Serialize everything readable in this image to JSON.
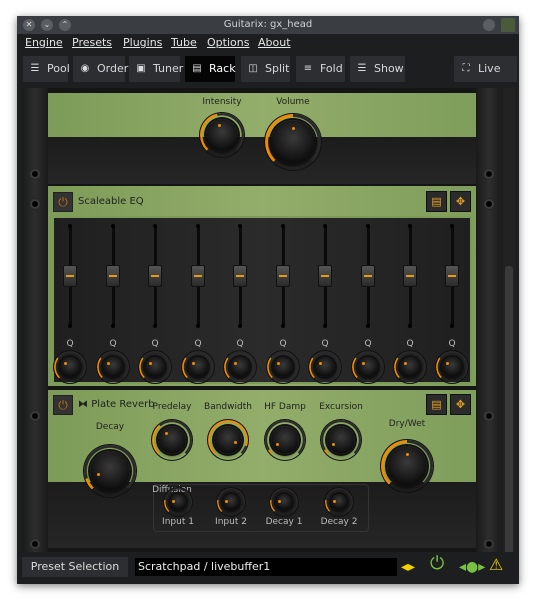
{
  "window": {
    "title": "Guitarix: gx_head"
  },
  "menu": [
    "Engine",
    "Presets",
    "Plugins",
    "Tube",
    "Options",
    "About"
  ],
  "toolbar": {
    "buttons": [
      {
        "label": "Pool",
        "icon": "list-icon"
      },
      {
        "label": "Order",
        "icon": "circle-icon"
      },
      {
        "label": "Tuner",
        "icon": "tuner-icon"
      },
      {
        "label": "Rack",
        "icon": "rack-icon",
        "active": true
      },
      {
        "label": "Split",
        "icon": "split-icon"
      },
      {
        "label": "Fold",
        "icon": "fold-icon"
      },
      {
        "label": "Show",
        "icon": "show-icon"
      },
      {
        "label": "Live",
        "icon": "fullscreen-icon"
      }
    ]
  },
  "top_panel": {
    "knobs": [
      {
        "label": "Intensity",
        "value": 0.45
      },
      {
        "label": "Volume",
        "value": 0.5
      }
    ]
  },
  "eq": {
    "title": "Scaleable EQ",
    "band_label": "Q",
    "bands": 10,
    "slider_value": 0.5,
    "q_value": 0.3
  },
  "reverb": {
    "title": "Plate Reverb",
    "knobs": [
      {
        "label": "Decay",
        "value": 0.1
      },
      {
        "label": "Predelay",
        "value": 0.35
      },
      {
        "label": "Bandwidth",
        "value": 0.9
      },
      {
        "label": "HF Damp",
        "value": 0.05
      },
      {
        "label": "Excursion",
        "value": 0.05
      },
      {
        "label": "Dry/Wet",
        "value": 0.5
      }
    ],
    "diffusion": {
      "label": "Diffusion",
      "knobs": [
        {
          "label": "Input 1",
          "value": 0.2
        },
        {
          "label": "Input 2",
          "value": 0.2
        },
        {
          "label": "Decay 1",
          "value": 0.2
        },
        {
          "label": "Decay 2",
          "value": 0.2
        }
      ]
    }
  },
  "status": {
    "preset_button": "Preset Selection",
    "preset_name": "Scratchpad / livebuffer1"
  },
  "colors": {
    "accent": "#f08c00",
    "panel_green": "#8aa763",
    "ok": "#7ac142",
    "warn": "#f5d000"
  }
}
